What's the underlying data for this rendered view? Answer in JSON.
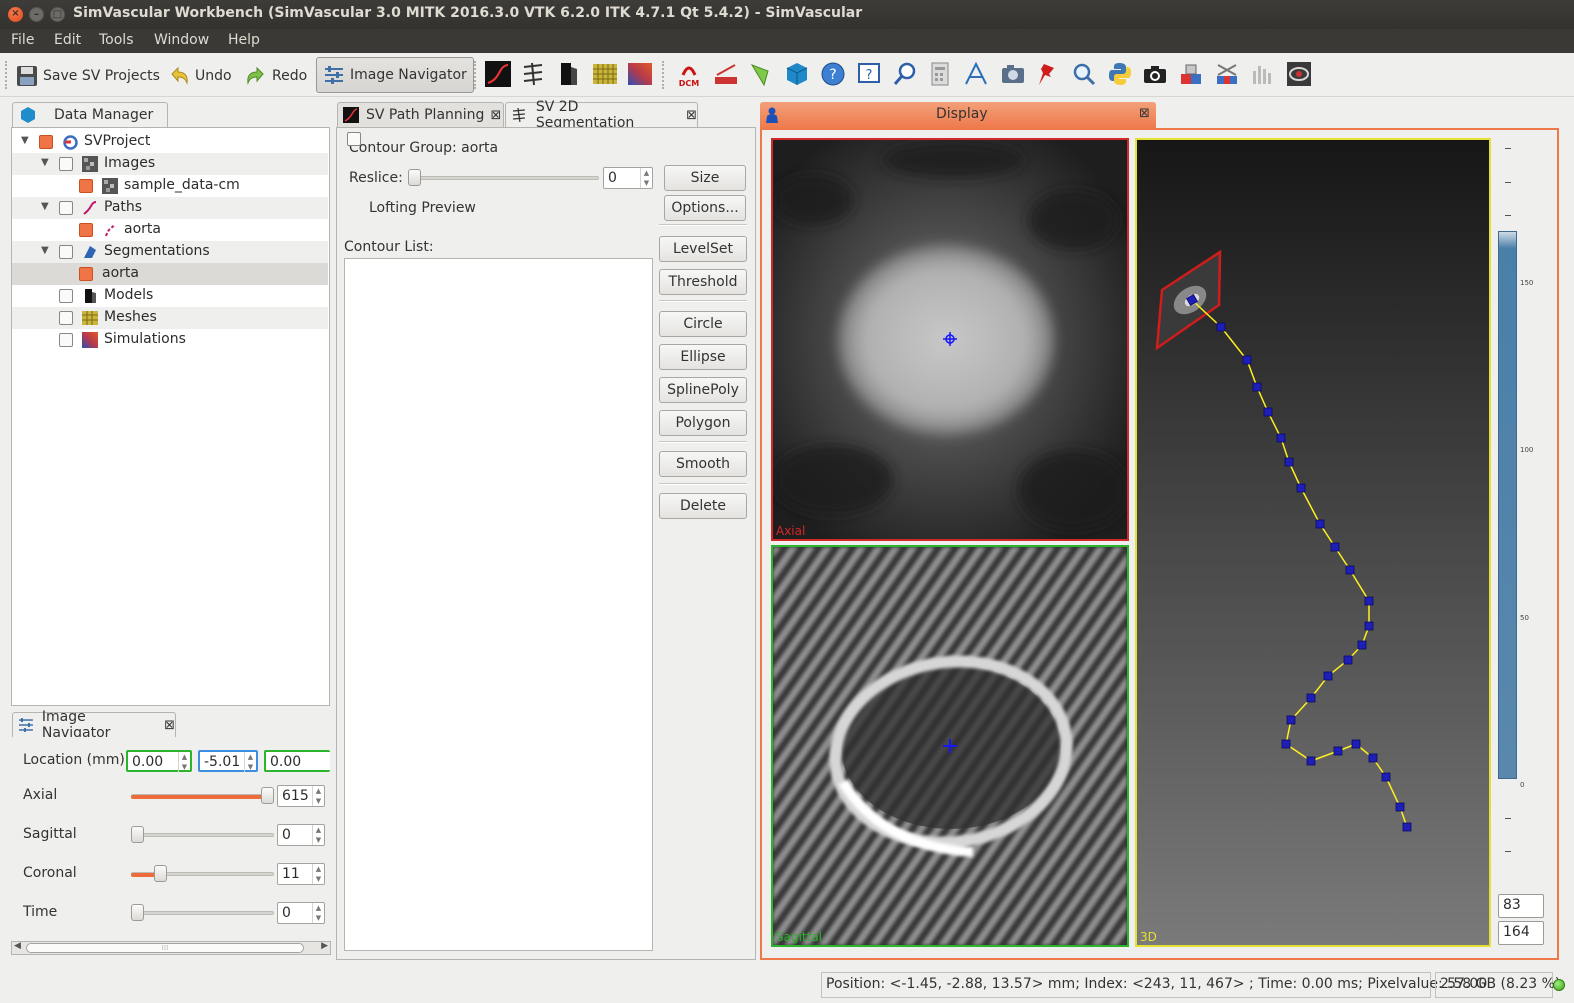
{
  "window": {
    "title": "SimVascular Workbench (SimVascular 3.0 MITK 2016.3.0 VTK 6.2.0 ITK 4.7.1 Qt 5.4.2) - SimVascular"
  },
  "menu": [
    "File",
    "Edit",
    "Tools",
    "Window",
    "Help"
  ],
  "toolbar": {
    "save_label": "Save SV Projects",
    "undo_label": "Undo",
    "redo_label": "Redo",
    "image_nav_label": "Image Navigator",
    "dcm_label": "DCM"
  },
  "data_manager": {
    "tab_label": "Data Manager",
    "items": [
      {
        "label": "SVProject"
      },
      {
        "label": "Images"
      },
      {
        "label": "sample_data-cm"
      },
      {
        "label": "Paths"
      },
      {
        "label": "aorta"
      },
      {
        "label": "Segmentations"
      },
      {
        "label": "aorta"
      },
      {
        "label": "Models"
      },
      {
        "label": "Meshes"
      },
      {
        "label": "Simulations"
      }
    ]
  },
  "image_navigator": {
    "tab_label": "Image Navigator",
    "close_glyph": "⊠",
    "location_label": "Location (mm)",
    "location_values": [
      "0.00",
      "-5.01",
      "0.00"
    ],
    "sliders": [
      {
        "label": "Axial",
        "value": "615",
        "fraction": 1.0
      },
      {
        "label": "Sagittal",
        "value": "0",
        "fraction": 0.0
      },
      {
        "label": "Coronal",
        "value": "11",
        "fraction": 0.18
      },
      {
        "label": "Time",
        "value": "0",
        "fraction": 0.0
      }
    ],
    "hscroll_grip": "⁞⁞⁞"
  },
  "segmentation": {
    "tabs": [
      {
        "label": "SV Path Planning",
        "close": "⊠"
      },
      {
        "label": "SV 2D Segmentation",
        "close": "⊠"
      }
    ],
    "contour_group_label": "Contour Group: aorta",
    "reslice_label": "Reslice:",
    "reslice_value": "0",
    "size_button": "Size",
    "options_button": "Options...",
    "lofting_label": "Lofting Preview",
    "contour_list_label": "Contour List:",
    "buttons": [
      "LevelSet",
      "Threshold",
      "Circle",
      "Ellipse",
      "SplinePoly",
      "Polygon",
      "Smooth",
      "Delete"
    ]
  },
  "display": {
    "tab_label": "Display",
    "close_glyph": "⊠",
    "views": {
      "axial": "Axial",
      "sagittal": "Sagittal",
      "threed": "3D"
    },
    "colorbar_ticks": [
      "150",
      "100",
      "50",
      "0"
    ],
    "level_values": [
      "83",
      "164"
    ],
    "colors": {
      "axial_border": "#d3282a",
      "sagittal_border": "#2db42d",
      "threed_border": "#e6e032",
      "accent": "#ee7a4c"
    }
  },
  "status": {
    "position_text": "Position: <-1.45, -2.88, 13.57> mm; Index: <243, 11, 467> ; Time: 0.00 ms; Pixelvalue: 57.00",
    "memory_text": "2.58 GB (8.23 %)"
  }
}
